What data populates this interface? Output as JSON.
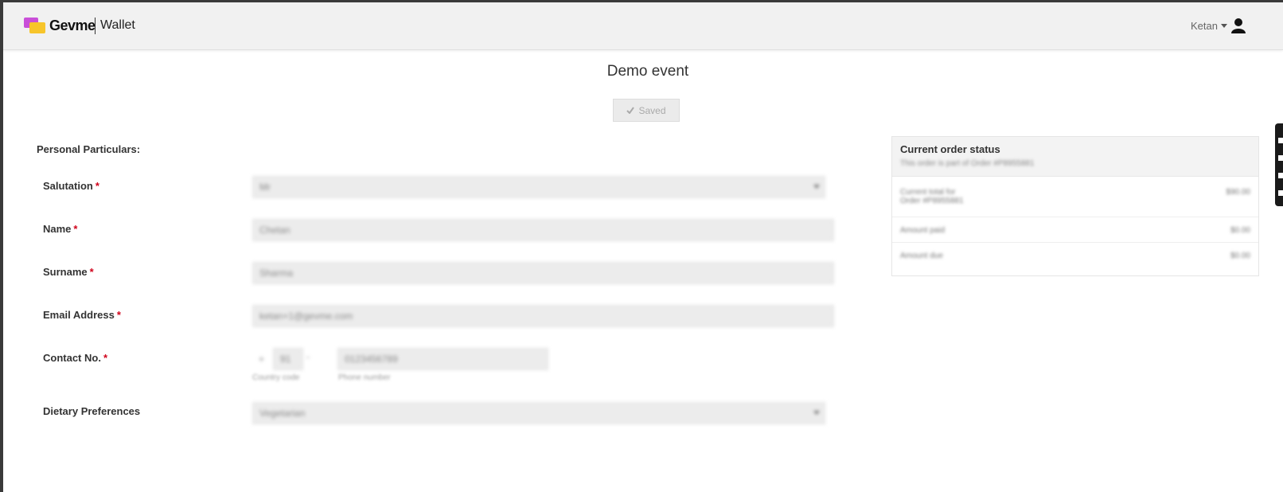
{
  "app": {
    "brand": "Gevme",
    "product": "Wallet",
    "user_name": "Ketan"
  },
  "page": {
    "title": "Demo event",
    "saved_label": "Saved"
  },
  "form": {
    "section_title": "Personal Particulars:",
    "fields": {
      "salutation": {
        "label": "Salutation",
        "value": "Mr"
      },
      "name": {
        "label": "Name",
        "value": "Chetan"
      },
      "surname": {
        "label": "Surname",
        "value": "Sharma"
      },
      "email": {
        "label": "Email Address",
        "value": "ketan+1@gevme.com"
      },
      "contact": {
        "label": "Contact No.",
        "plus": "+",
        "country_code": "91",
        "dash": "-",
        "phone": "0123456789",
        "country_code_hint": "Country code",
        "phone_hint": "Phone number"
      },
      "dietary": {
        "label": "Dietary Preferences",
        "value": "Vegetarian"
      }
    },
    "required_marker": "*"
  },
  "order_status": {
    "title": "Current order status",
    "subtitle": "This order is part of Order #P8955881",
    "rows": [
      {
        "label_line1": "Current total for",
        "label_line2": "Order #P8955881",
        "amount": "$90.00"
      },
      {
        "label_line1": "Amount paid",
        "label_line2": "",
        "amount": "$0.00"
      },
      {
        "label_line1": "Amount due",
        "label_line2": "",
        "amount": "$0.00"
      }
    ]
  },
  "colors": {
    "required": "#d0021b",
    "field_bg": "#ececec",
    "topbar_bg": "#f1f1f1"
  },
  "icons": [
    "logo-mark-icon",
    "caret-down-icon",
    "user-icon",
    "check-icon",
    "select-arrow-icon"
  ]
}
